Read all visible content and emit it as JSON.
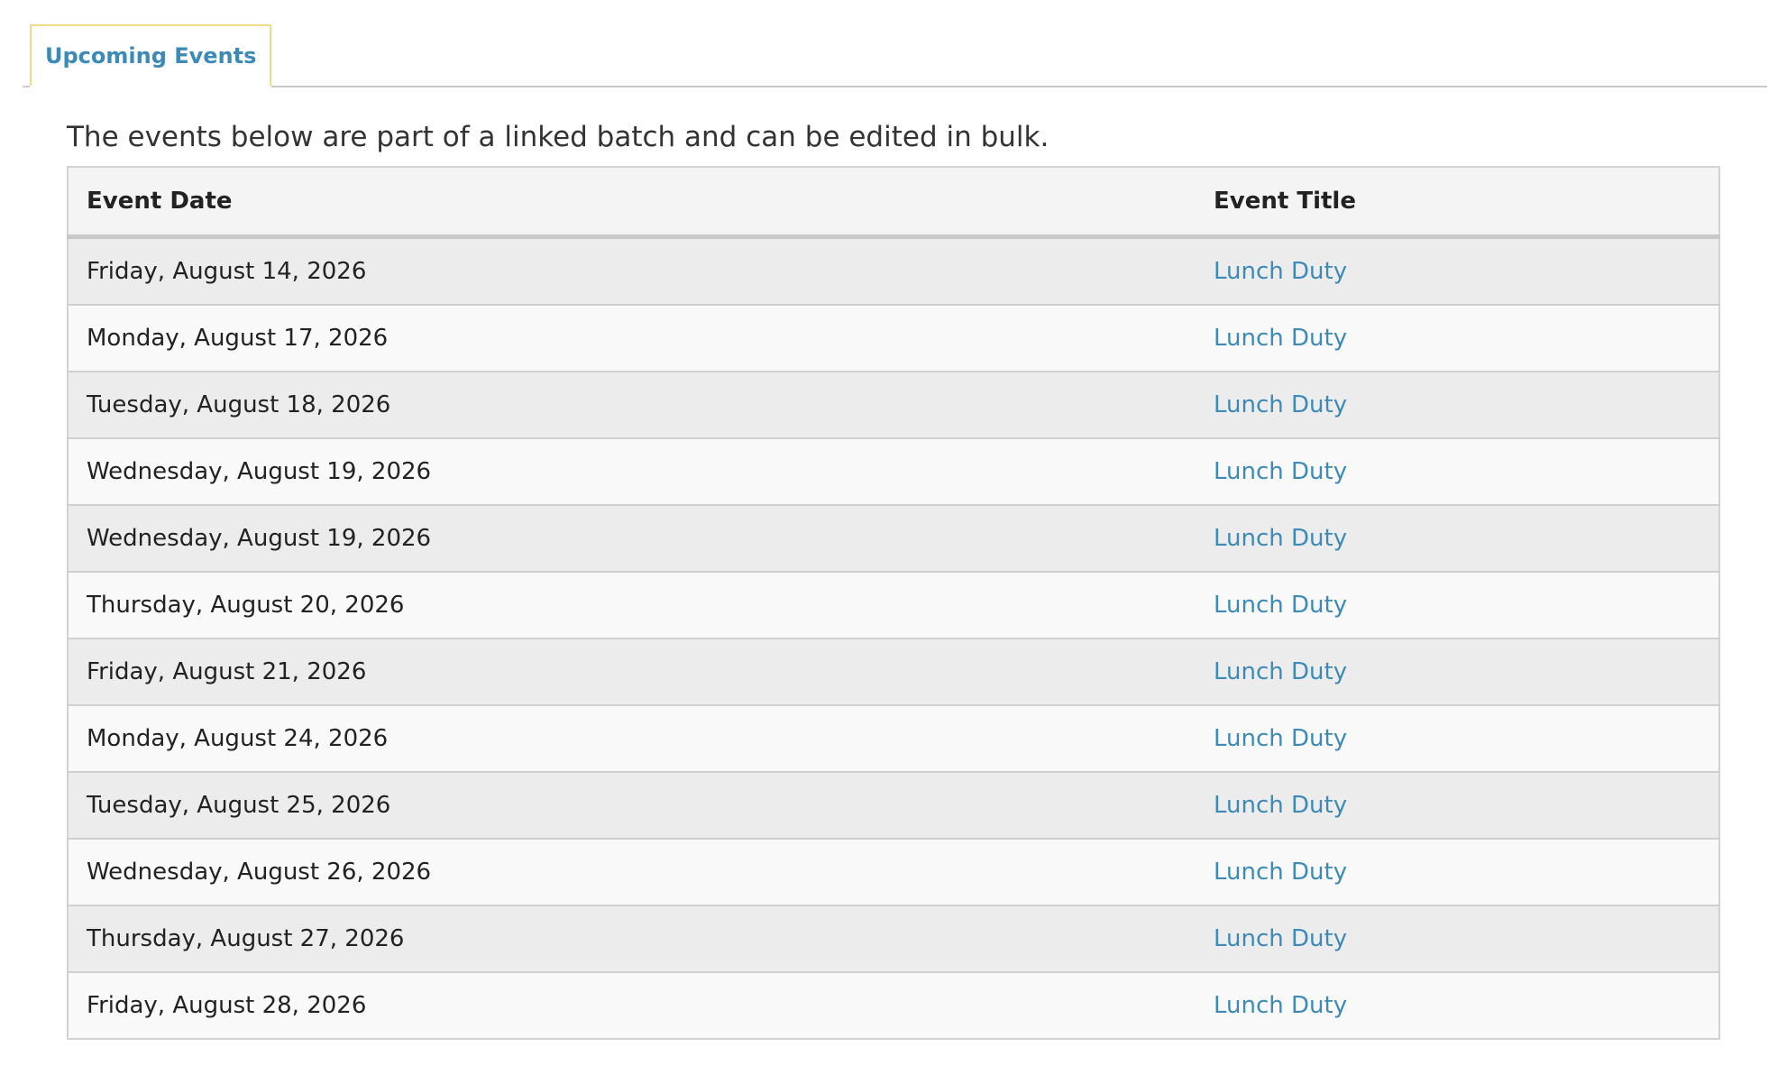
{
  "tabs": [
    {
      "label": "Upcoming Events",
      "active": true
    }
  ],
  "intro_text": "The events below are part of a linked batch and can be edited in bulk.",
  "table": {
    "columns": [
      "Event Date",
      "Event Title"
    ],
    "rows": [
      {
        "date": "Friday, August 14, 2026",
        "title": "Lunch Duty"
      },
      {
        "date": "Monday, August 17, 2026",
        "title": "Lunch Duty"
      },
      {
        "date": "Tuesday, August 18, 2026",
        "title": "Lunch Duty"
      },
      {
        "date": "Wednesday, August 19, 2026",
        "title": "Lunch Duty"
      },
      {
        "date": "Wednesday, August 19, 2026",
        "title": "Lunch Duty"
      },
      {
        "date": "Thursday, August 20, 2026",
        "title": "Lunch Duty"
      },
      {
        "date": "Friday, August 21, 2026",
        "title": "Lunch Duty"
      },
      {
        "date": "Monday, August 24, 2026",
        "title": "Lunch Duty"
      },
      {
        "date": "Tuesday, August 25, 2026",
        "title": "Lunch Duty"
      },
      {
        "date": "Wednesday, August 26, 2026",
        "title": "Lunch Duty"
      },
      {
        "date": "Thursday, August 27, 2026",
        "title": "Lunch Duty"
      },
      {
        "date": "Friday, August 28, 2026",
        "title": "Lunch Duty"
      }
    ]
  },
  "colors": {
    "link": "#3c8ab8",
    "tab_border": "#eedc8a",
    "row_odd": "#ececec",
    "row_even": "#f9f9f9",
    "header_bg": "#f4f4f4"
  }
}
